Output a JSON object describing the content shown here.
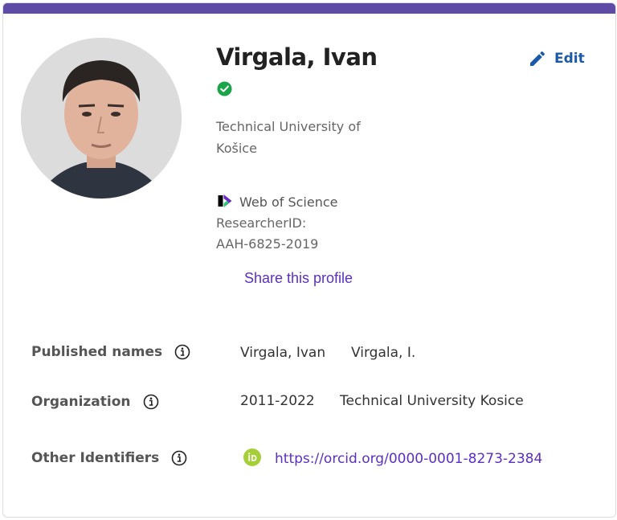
{
  "profile": {
    "name": "Virgala, Ivan",
    "edit_label": "Edit",
    "affiliation": "Technical University of Košice",
    "wos_brand": "Web of Science",
    "researcher_id_label": "ResearcherID:",
    "researcher_id": "AAH-6825-2019",
    "share_label": "Share this profile"
  },
  "details": {
    "published_names": {
      "label": "Published names",
      "values": [
        "Virgala, Ivan",
        "Virgala, I."
      ]
    },
    "organization": {
      "label": "Organization",
      "years": "2011-2022",
      "name": "Technical University Kosice"
    },
    "other_identifiers": {
      "label": "Other Identifiers",
      "orcid_url": "https://orcid.org/0000-0001-8273-2384"
    }
  },
  "colors": {
    "accent_stripe": "#5e4ba6",
    "link": "#5b2ec4",
    "edit": "#1c5aa8",
    "verified": "#1aa54a",
    "orcid": "#a6ce39"
  },
  "icons": [
    "avatar-photo",
    "verified-check-icon",
    "pencil-icon",
    "web-of-science-logo",
    "info-icon",
    "orcid-icon"
  ]
}
